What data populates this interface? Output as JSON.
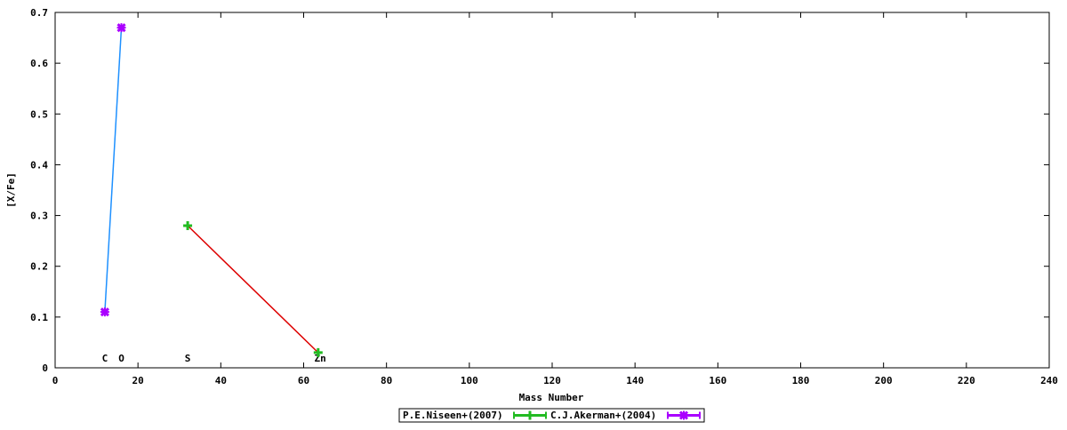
{
  "chart_data": {
    "type": "line",
    "title": "",
    "xlabel": "Mass Number",
    "ylabel": "[X/Fe]",
    "xlim": [
      0,
      240
    ],
    "ylim": [
      0,
      0.7
    ],
    "x_ticks": [
      0,
      20,
      40,
      60,
      80,
      100,
      120,
      140,
      160,
      180,
      200,
      220,
      240
    ],
    "y_ticks": [
      0,
      0.1,
      0.2,
      0.3,
      0.4,
      0.5,
      0.6,
      0.7
    ],
    "x_tick_labels": [
      "0",
      "20",
      "40",
      "60",
      "80",
      "100",
      "120",
      "140",
      "160",
      "180",
      "200",
      "220",
      "240"
    ],
    "y_tick_labels": [
      "0",
      "0.1",
      "0.2",
      "0.3",
      "0.4",
      "0.5",
      "0.6",
      "0.7"
    ],
    "grid": false,
    "legend_position": "bottom",
    "element_labels": [
      {
        "text": "C",
        "x": 12
      },
      {
        "text": "O",
        "x": 16
      },
      {
        "text": "S",
        "x": 32
      },
      {
        "text": "Zn",
        "x": 64
      }
    ],
    "series": [
      {
        "name": "P.E.Niseen+(2007)",
        "marker": "plus",
        "marker_color": "#22bb22",
        "line_color": "#dd0000",
        "points": [
          {
            "x": 32,
            "y": 0.28
          },
          {
            "x": 63.5,
            "y": 0.03
          }
        ]
      },
      {
        "name": "C.J.Akerman+(2004)",
        "marker": "cross",
        "marker_color": "#aa00ff",
        "line_color": "#1e90ff",
        "points": [
          {
            "x": 12,
            "y": 0.11
          },
          {
            "x": 16,
            "y": 0.67
          }
        ]
      }
    ]
  }
}
